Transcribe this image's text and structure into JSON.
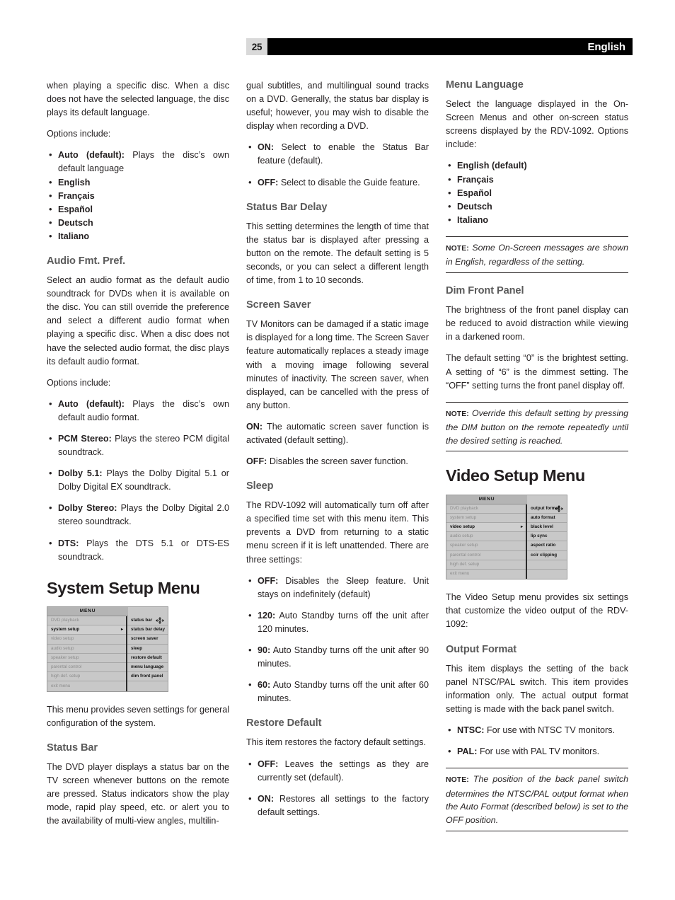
{
  "header": {
    "page_number": "25",
    "language": "English"
  },
  "col1": {
    "p_intro": "when playing a specific disc. When a disc does not have the selected language, the disc plays its default language.",
    "p_options": "Options include:",
    "lang_options": [
      {
        "bold": "Auto (default):",
        "rest": " Plays the disc’s own default language"
      },
      {
        "bold": "English",
        "rest": ""
      },
      {
        "bold": "Français",
        "rest": ""
      },
      {
        "bold": "Español",
        "rest": ""
      },
      {
        "bold": "Deutsch",
        "rest": ""
      },
      {
        "bold": "Italiano",
        "rest": ""
      }
    ],
    "audio_fmt_title": "Audio Fmt. Pref.",
    "audio_fmt_p1": "Select an audio format as the default audio soundtrack for DVDs when it is available on the disc. You can still override the preference and select a different audio format when playing a specific disc. When a disc does not have the selected audio format, the disc plays its default audio format.",
    "audio_fmt_p2": "Options include:",
    "audio_options": [
      {
        "bold": "Auto (default):",
        "rest": " Plays the disc’s own default audio format."
      },
      {
        "bold": "PCM Stereo:",
        "rest": " Plays the stereo PCM digital soundtrack."
      },
      {
        "bold": "Dolby 5.1:",
        "rest": " Plays the Dolby Digital 5.1 or Dolby Digital EX soundtrack."
      },
      {
        "bold": "Dolby Stereo:",
        "rest": " Plays the Dolby Digital 2.0 stereo soundtrack."
      },
      {
        "bold": "DTS:",
        "rest": " Plays the DTS 5.1 or DTS-ES soundtrack."
      }
    ],
    "system_setup_title": "System Setup Menu",
    "system_menu": {
      "title": "MENU",
      "left_items": [
        {
          "label": "DVD playback",
          "state": "dim"
        },
        {
          "label": "system setup",
          "state": "active",
          "arrow": "▸"
        },
        {
          "label": "video setup",
          "state": "dim"
        },
        {
          "label": "audio setup",
          "state": "dim"
        },
        {
          "label": "speaker setup",
          "state": "dim"
        },
        {
          "label": "parental control",
          "state": "dim"
        },
        {
          "label": "high def. setup",
          "state": "dim"
        },
        {
          "label": "exit menu",
          "state": "dim"
        }
      ],
      "right_items": [
        {
          "label": "status bar",
          "state": "bright",
          "nav": true
        },
        {
          "label": "status bar delay",
          "state": "bright"
        },
        {
          "label": "screen saver",
          "state": "bright"
        },
        {
          "label": "sleep",
          "state": "bright"
        },
        {
          "label": "restore default",
          "state": "bright"
        },
        {
          "label": "menu language",
          "state": "bright"
        },
        {
          "label": "dim front panel",
          "state": "bright"
        },
        {
          "label": "",
          "state": "empty"
        }
      ]
    },
    "p_menu_desc": "This menu provides seven settings for general configuration of the system.",
    "status_bar_title": "Status Bar",
    "status_bar_p": "The DVD player displays a status bar on the TV screen whenever buttons on the remote are pressed. Status indicators show the play mode, rapid play speed, etc. or alert you to the availability of multi-view angles, multilin-"
  },
  "col2": {
    "p_cont": "gual subtitles, and multilingual sound tracks on a DVD. Generally, the status bar display is useful; however, you may wish to disable the display when recording a DVD.",
    "status_bar_options": [
      {
        "bold": "ON:",
        "rest": " Select to enable the Status Bar feature (default)."
      },
      {
        "bold": "OFF:",
        "rest": " Select to disable the Guide feature."
      }
    ],
    "status_delay_title": "Status Bar Delay",
    "status_delay_p": "This setting determines the length of time that the status bar is displayed after pressing a button on the remote. The default setting is 5 seconds, or you can select a different length of time, from 1 to 10 seconds.",
    "screen_saver_title": "Screen Saver",
    "screen_saver_p": "TV Monitors can be damaged if a static image is displayed for a long time. The Screen Saver feature automatically replaces a steady image with a moving image following several minutes of inactivity. The screen saver, when displayed, can be cancelled with the press of any button.",
    "screen_saver_on": {
      "bold": "ON:",
      "rest": " The automatic screen saver function is activated (default setting)."
    },
    "screen_saver_off": {
      "bold": "OFF:",
      "rest": " Disables the screen saver function."
    },
    "sleep_title": "Sleep",
    "sleep_p": "The RDV-1092 will automatically turn off after a specified time set with this menu item. This prevents a DVD from returning to a static menu screen if it is left unattended. There are three settings:",
    "sleep_options": [
      {
        "bold": "OFF:",
        "rest": " Disables the Sleep feature. Unit stays on indefinitely (default)"
      },
      {
        "bold": "120:",
        "rest": " Auto Standby turns off the unit after 120 minutes."
      },
      {
        "bold": "90:",
        "rest": " Auto Standby turns off the unit after 90 minutes."
      },
      {
        "bold": "60:",
        "rest": " Auto Standby turns off the unit after 60 minutes."
      }
    ],
    "restore_title": "Restore Default",
    "restore_p": "This item restores the factory default settings.",
    "restore_options": [
      {
        "bold": "OFF:",
        "rest": " Leaves the settings as they are currently set (default)."
      },
      {
        "bold": "ON:",
        "rest": " Restores all settings to the factory default settings."
      }
    ]
  },
  "col3": {
    "menu_lang_title": "Menu Language",
    "menu_lang_p": "Select the language displayed in the On-Screen Menus and other on-screen status screens displayed by the RDV-1092. Options include:",
    "menu_lang_options": [
      {
        "bold": "English (default)",
        "rest": ""
      },
      {
        "bold": "Français",
        "rest": ""
      },
      {
        "bold": "Español",
        "rest": ""
      },
      {
        "bold": "Deutsch",
        "rest": ""
      },
      {
        "bold": "Italiano",
        "rest": ""
      }
    ],
    "note_label": "NOTE:",
    "note1": " Some On-Screen messages are shown in English, regardless of the setting.",
    "dim_front_title": "Dim Front Panel",
    "dim_front_p1": "The brightness of the front panel display can be reduced to avoid distraction while viewing in a darkened room.",
    "dim_front_p2": "The default setting “0” is the brightest setting. A setting of “6” is the dimmest setting. The “OFF” setting turns the front panel display off.",
    "note2": " Override this default setting by pressing the DIM button on the remote repeatedly until the desired setting is reached.",
    "video_setup_title": "Video Setup Menu",
    "video_menu": {
      "title": "MENU",
      "left_items": [
        {
          "label": "DVD playback",
          "state": "dim"
        },
        {
          "label": "system setup",
          "state": "dim"
        },
        {
          "label": "video setup",
          "state": "active",
          "arrow": "▸"
        },
        {
          "label": "audio setup",
          "state": "dim"
        },
        {
          "label": "speaker setup",
          "state": "dim"
        },
        {
          "label": "parental control",
          "state": "dim"
        },
        {
          "label": "high def. setup",
          "state": "dim"
        },
        {
          "label": "exit menu",
          "state": "dim"
        }
      ],
      "right_items": [
        {
          "label": "output format",
          "state": "bright",
          "nav": true
        },
        {
          "label": "auto format",
          "state": "bright"
        },
        {
          "label": "black level",
          "state": "bright"
        },
        {
          "label": "lip sync",
          "state": "bright"
        },
        {
          "label": "aspect ratio",
          "state": "bright"
        },
        {
          "label": "ccir clipping",
          "state": "bright"
        },
        {
          "label": "",
          "state": "empty"
        },
        {
          "label": "",
          "state": "empty"
        }
      ]
    },
    "video_p": "The Video Setup menu provides six settings that customize the video output of the RDV-1092:",
    "output_format_title": "Output Format",
    "output_format_p": "This item displays the setting of the back panel NTSC/PAL switch. This item provides information only. The actual output format setting is made with the back panel switch.",
    "output_format_options": [
      {
        "bold": "NTSC:",
        "rest": " For use with NTSC TV monitors."
      },
      {
        "bold": "PAL:",
        "rest": " For use with PAL TV monitors."
      }
    ],
    "note3": " The position of the back panel switch determines the NTSC/PAL output format when the Auto Format (described below) is set to the OFF position."
  }
}
